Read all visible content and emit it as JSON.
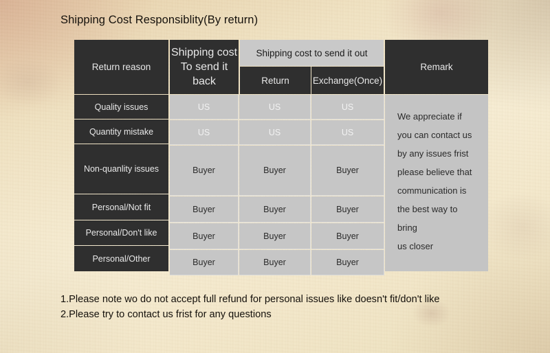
{
  "title": "Shipping Cost Responsiblity(By return)",
  "table": {
    "headers": {
      "return_reason": "Return reason",
      "send_back_line1": "Shipping cost",
      "send_back_line2": "To send it back",
      "send_out_group": "Shipping cost to send it out",
      "send_out_return": "Return",
      "send_out_exchange": "Exchange(Once)",
      "remark": "Remark"
    },
    "rows": [
      {
        "reason": "Quality issues",
        "send_back": "US",
        "return": "US",
        "exchange": "US"
      },
      {
        "reason": "Quantity mistake",
        "send_back": "US",
        "return": "US",
        "exchange": "US"
      },
      {
        "reason": "Non-quanlity issues",
        "send_back": "Buyer",
        "return": "Buyer",
        "exchange": "Buyer"
      },
      {
        "reason": "Personal/Not fit",
        "send_back": "Buyer",
        "return": "Buyer",
        "exchange": "Buyer"
      },
      {
        "reason": "Personal/Don't like",
        "send_back": "Buyer",
        "return": "Buyer",
        "exchange": "Buyer"
      },
      {
        "reason": "Personal/Other",
        "send_back": "Buyer",
        "return": "Buyer",
        "exchange": "Buyer"
      }
    ],
    "remark_lines": [
      "We appreciate if",
      "you can contact us",
      "by any issues frist",
      "please believe that",
      "communication is",
      "the best way to bring",
      "us closer"
    ]
  },
  "notes": [
    "1.Please note wo do not accept full refund for personal issues like doesn't fit/don't like",
    "2.Please try to contact us frist for any questions"
  ],
  "colors": {
    "header_dark": "#2f2f2f",
    "header_light": "#c9c9c9",
    "cell_gray": "#c6c6c6",
    "remark_gray": "#c4c4c4",
    "gridline": "#dcdcdc",
    "text_on_dark": "#e8e8e8",
    "text_dark": "#1a1a1a",
    "paper": "#f0e2c2"
  }
}
